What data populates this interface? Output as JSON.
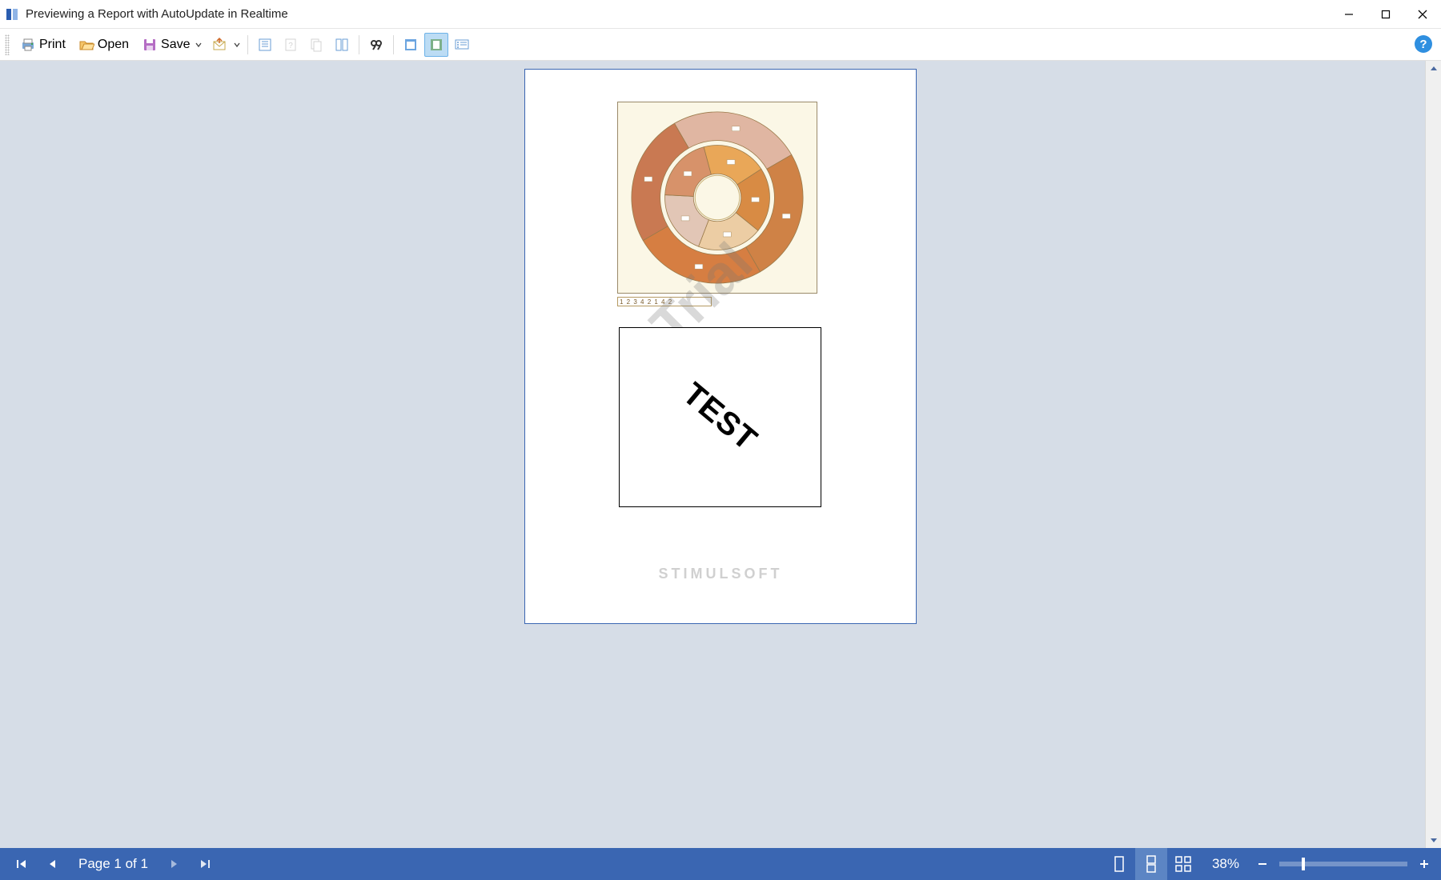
{
  "window": {
    "title": "Previewing a Report with AutoUpdate in Realtime"
  },
  "toolbar": {
    "print": "Print",
    "open": "Open",
    "save": "Save"
  },
  "page": {
    "test_label": "TEST",
    "watermark_trial": "Trial",
    "watermark_brand": "STIMULSOFT",
    "legend_text": "1 2 3 4 2 1 4 2"
  },
  "status": {
    "page_label": "Page 1 of 1",
    "zoom": "38%"
  },
  "chart_data": {
    "type": "pie",
    "title": "",
    "rings": [
      {
        "name": "inner",
        "slices": [
          {
            "label": "1",
            "value": 20,
            "color": "#e9a758"
          },
          {
            "label": "2",
            "value": 20,
            "color": "#d88b44"
          },
          {
            "label": "3",
            "value": 20,
            "color": "#eccda4"
          },
          {
            "label": "4",
            "value": 20,
            "color": "#e2c6b6"
          },
          {
            "label": "5",
            "value": 20,
            "color": "#d7926a"
          }
        ]
      },
      {
        "name": "outer",
        "slices": [
          {
            "label": "1",
            "value": 25,
            "color": "#e0b6a2"
          },
          {
            "label": "2",
            "value": 25,
            "color": "#cf8246"
          },
          {
            "label": "3",
            "value": 25,
            "color": "#d67e42"
          },
          {
            "label": "4",
            "value": 25,
            "color": "#c97952"
          }
        ]
      }
    ]
  }
}
